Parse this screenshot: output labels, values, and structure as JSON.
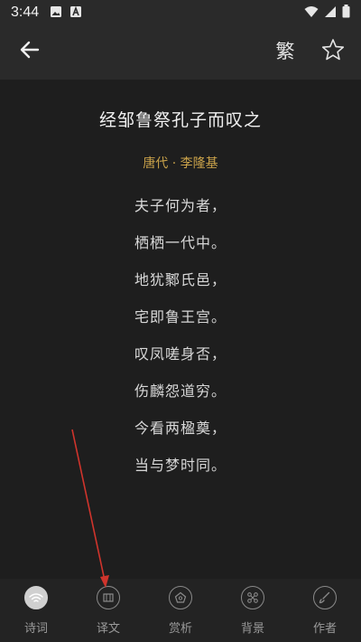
{
  "status_bar": {
    "time": "3:44",
    "notif_icons": [
      "image-icon",
      "a-app-icon"
    ],
    "right_icons": [
      "wifi-icon",
      "signal-icon",
      "battery-icon"
    ]
  },
  "app_bar": {
    "traditional_label": "繁",
    "icons": [
      "back-arrow-icon",
      "star-icon"
    ]
  },
  "poem": {
    "title": "经邹鲁祭孔子而叹之",
    "author": "唐代 · 李隆基",
    "lines": [
      "夫子何为者，",
      "栖栖一代中。",
      "地犹鄹氏邑，",
      "宅即鲁王宫。",
      "叹凤嗟身否，",
      "伤麟怨道穷。",
      "今看两楹奠，",
      "当与梦时同。"
    ]
  },
  "bottom_nav": {
    "items": [
      {
        "label": "诗词",
        "icon": "poem-icon",
        "active": true
      },
      {
        "label": "译文",
        "icon": "translation-icon",
        "active": false
      },
      {
        "label": "赏析",
        "icon": "appreciation-icon",
        "active": false
      },
      {
        "label": "背景",
        "icon": "background-icon",
        "active": false
      },
      {
        "label": "作者",
        "icon": "author-icon",
        "active": false
      }
    ]
  },
  "colors": {
    "background": "#1e1e1e",
    "bar": "#2a2a2a",
    "author": "#c9a24a",
    "annotation_arrow": "#d0342c"
  }
}
